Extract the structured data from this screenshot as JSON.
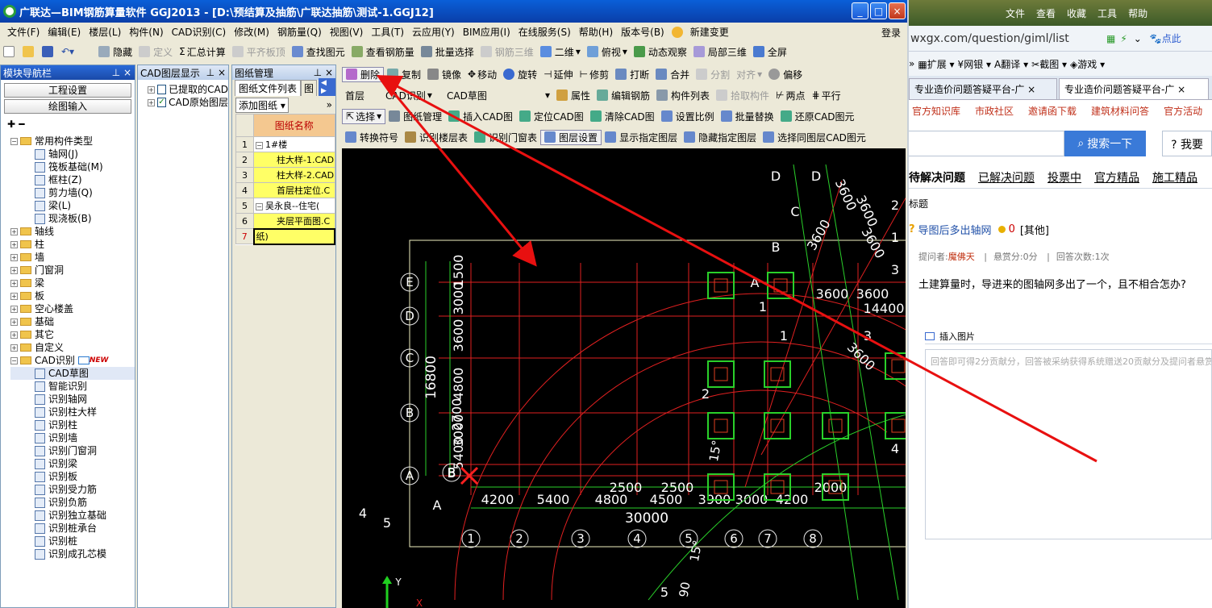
{
  "app": {
    "title": "广联达—BIM钢筋算量软件 GGJ2013 - [D:\\预结算及抽筋\\广联达抽筋\\测试-1.GGJ12]",
    "login": "登录",
    "menu": [
      "文件(F)",
      "编辑(E)",
      "楼层(L)",
      "构件(N)",
      "CAD识别(C)",
      "修改(M)",
      "钢筋量(Q)",
      "视图(V)",
      "工具(T)",
      "云应用(Y)",
      "BIM应用(I)",
      "在线服务(S)",
      "帮助(H)",
      "版本号(B)",
      "新建变更"
    ],
    "toolbar1": [
      "隐藏",
      "定义",
      "汇总计算",
      "平齐板顶",
      "查找图元",
      "查看钢筋量",
      "批量选择",
      "钢筋三维",
      "二维",
      "俯视",
      "动态观察",
      "局部三维",
      "全屏"
    ],
    "toolbar2": [
      "删除",
      "复制",
      "镜像",
      "移动",
      "旋转",
      "延伸",
      "修剪",
      "打断",
      "合并",
      "分割",
      "对齐",
      "偏移"
    ],
    "toolbar3": [
      "首层",
      "CAD识别",
      "CAD草图",
      "属性",
      "编辑钢筋",
      "构件列表",
      "拾取构件",
      "两点",
      "平行"
    ],
    "toolbar4": [
      "选择",
      "图纸管理",
      "插入CAD图",
      "定位CAD图",
      "清除CAD图",
      "设置比例",
      "批量替换",
      "还原CAD图元"
    ],
    "toolbar5": [
      "转换符号",
      "识别楼层表",
      "识别门窗表",
      "图层设置",
      "显示指定图层",
      "隐藏指定图层",
      "选择同图层CAD图元"
    ]
  },
  "nav": {
    "title": "模块导航栏",
    "btn1": "工程设置",
    "btn2": "绘图输入",
    "common": "常用构件类型",
    "common_items": [
      "轴网(J)",
      "筏板基础(M)",
      "框柱(Z)",
      "剪力墙(Q)",
      "梁(L)",
      "现浇板(B)"
    ],
    "folders": [
      "轴线",
      "柱",
      "墙",
      "门窗洞",
      "梁",
      "板",
      "空心楼盖",
      "基础",
      "其它",
      "自定义"
    ],
    "cad": "CAD识别",
    "new_badge": "NEW",
    "cad_items": [
      "CAD草图",
      "智能识别",
      "识别轴网",
      "识别柱大样",
      "识别柱",
      "识别墙",
      "识别门窗洞",
      "识别梁",
      "识别板",
      "识别受力筋",
      "识别负筋",
      "识别独立基础",
      "识别桩承台",
      "识别桩",
      "识别成孔芯模"
    ]
  },
  "layer_panel": {
    "title": "CAD图层显示",
    "items": [
      "已提取的CAD",
      "CAD原始图层"
    ]
  },
  "drawing_panel": {
    "title": "图纸管理",
    "tab1": "图纸文件列表",
    "tab2": "图",
    "add_btn": "添加图纸",
    "col_header": "图纸名称",
    "rows": [
      {
        "no": "1",
        "name": "1#楼",
        "expand": "−"
      },
      {
        "no": "2",
        "name": "柱大样-1.CAD",
        "expand": ""
      },
      {
        "no": "3",
        "name": "柱大样-2.CAD",
        "expand": ""
      },
      {
        "no": "4",
        "name": "首层柱定位.C",
        "expand": ""
      },
      {
        "no": "5",
        "name": "吴永良--住宅(",
        "expand": "−"
      },
      {
        "no": "6",
        "name": "夹层平面图.C",
        "expand": ""
      },
      {
        "no": "7",
        "name": "纸)",
        "expand": ""
      }
    ]
  },
  "cad": {
    "axis_letters": [
      "E",
      "D",
      "C",
      "B",
      "A"
    ],
    "axis_numbers": [
      "1",
      "2",
      "3",
      "4",
      "5",
      "6",
      "7",
      "8"
    ],
    "dims_bottom": [
      "4200",
      "5400",
      "4800",
      "4500",
      "3900",
      "3000",
      "4200"
    ],
    "dims_top_row": [
      "2500",
      "2500",
      "2000"
    ],
    "total_x": "30000",
    "total_y": "16800",
    "dims_left": [
      "1500",
      "3000",
      "3600",
      "4800",
      "3000",
      "5400",
      "2700"
    ],
    "right_dims": [
      "3600",
      "3600",
      "14400"
    ],
    "misc_labels": [
      "D",
      "D",
      "C",
      "B",
      "A",
      "1",
      "1",
      "2",
      "2",
      "3",
      "3",
      "4",
      "5",
      "A",
      "B",
      "B",
      "4",
      "5",
      "1",
      "3600",
      "3600",
      "3600",
      "3600",
      "3600",
      "15°",
      "15°",
      "90",
      "Y",
      "X"
    ]
  },
  "browser": {
    "menu": [
      "文件",
      "查看",
      "收藏",
      "工具",
      "帮助"
    ],
    "address": "wxgx.com/question/giml/list",
    "toolbar": [
      "扩展",
      "网银",
      "翻译",
      "截图",
      "游戏"
    ],
    "tabs": [
      "专业造价问题答疑平台-广",
      "专业造价问题答疑平台-广"
    ],
    "links": [
      "官方知识库",
      "市政社区",
      "邀请函下载",
      "建筑材料问答",
      "官方活动"
    ],
    "search_btn": "搜索一下",
    "ask_btn": "我要",
    "qtabs": [
      "待解决问题",
      "已解决问题",
      "投票中",
      "官方精品",
      "施工精品"
    ],
    "section": "标题",
    "question_title": "导图后多出轴网",
    "score": "0",
    "category": "[其他]",
    "meta_asker_label": "提问者:",
    "meta_asker": "魔佛天",
    "meta_reward": "悬赏分:0分",
    "meta_answers": "回答次数:1次",
    "question_body": "土建算量时，导进来的图轴网多出了一个，且不相合怎办?",
    "insert_image": "插入图片",
    "answer_placeholder": "回答即可得2分贡献分，回答被采纳获得系统赠送20贡献分及提问者悬赏"
  },
  "colors": {
    "titlebar": "#0a4bc4",
    "canvas": "#000000",
    "grid": "#e02020",
    "text_green": "#ffffff",
    "arrow": "#e81010",
    "highlight": "#ffff66"
  }
}
